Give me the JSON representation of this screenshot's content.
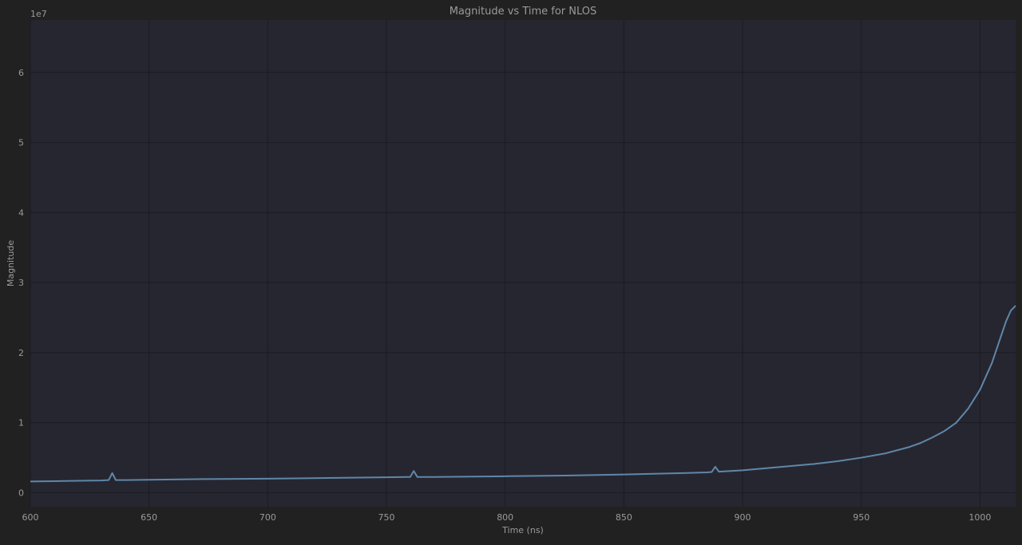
{
  "chart_data": {
    "type": "line",
    "title": "Magnitude vs Time for NLOS",
    "xlabel": "Time (ns)",
    "ylabel": "Magnitude",
    "y_scale_label": "1e7",
    "xlim": [
      600,
      1015
    ],
    "ylim": [
      -2000000,
      67500000
    ],
    "x_ticks": [
      600,
      650,
      700,
      750,
      800,
      850,
      900,
      950,
      1000
    ],
    "y_ticks": [
      0,
      10000000,
      20000000,
      30000000,
      40000000,
      50000000,
      60000000
    ],
    "y_tick_labels": [
      "0",
      "1",
      "2",
      "3",
      "4",
      "5",
      "6"
    ],
    "grid": true,
    "colors": {
      "background": "#212121",
      "plot_area": "#262631",
      "line": "#5f87a8",
      "grid": "#1b1b22",
      "text": "#9a9a9a"
    },
    "series": [
      {
        "x": [
          600,
          610,
          620,
          630,
          633,
          634.5,
          636,
          640,
          650,
          675,
          700,
          725,
          750,
          760,
          761.5,
          763,
          770,
          800,
          825,
          850,
          875,
          885,
          887,
          888.5,
          890,
          900,
          910,
          920,
          930,
          940,
          950,
          960,
          970,
          975,
          980,
          985,
          990,
          995,
          1000,
          1005,
          1008,
          1011,
          1013,
          1015
        ],
        "y": [
          1600000,
          1650000,
          1700000,
          1750000,
          1800000,
          2800000,
          1800000,
          1800000,
          1850000,
          1950000,
          2000000,
          2100000,
          2200000,
          2250000,
          3100000,
          2250000,
          2250000,
          2350000,
          2450000,
          2600000,
          2800000,
          2900000,
          2950000,
          3700000,
          3000000,
          3200000,
          3500000,
          3800000,
          4100000,
          4500000,
          5000000,
          5600000,
          6500000,
          7100000,
          7900000,
          8800000,
          10000000,
          12000000,
          14700000,
          18500000,
          21500000,
          24500000,
          26000000,
          26700000
        ]
      }
    ]
  }
}
